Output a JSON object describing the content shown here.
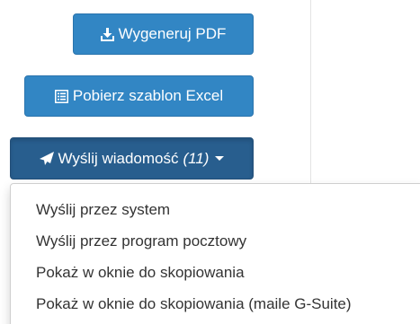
{
  "buttons": {
    "generate_pdf": {
      "label": "Wygeneruj PDF",
      "icon": "download-icon"
    },
    "download_excel_template": {
      "label": "Pobierz szablon Excel",
      "icon": "list-icon"
    },
    "send_message": {
      "label": "Wyślij wiadomość",
      "count": "(11)",
      "icon": "paper-plane-icon"
    }
  },
  "send_menu": {
    "items": [
      {
        "label": "Wyślij przez system"
      },
      {
        "label": "Wyślij przez program pocztowy"
      },
      {
        "label": "Pokaż w oknie do skopiowania"
      },
      {
        "label": "Pokaż w oknie do skopiowania (maile G-Suite)"
      }
    ]
  },
  "colors": {
    "primary_button": "#3286c4",
    "active_button": "#285e8e",
    "menu_text": "#333333"
  }
}
